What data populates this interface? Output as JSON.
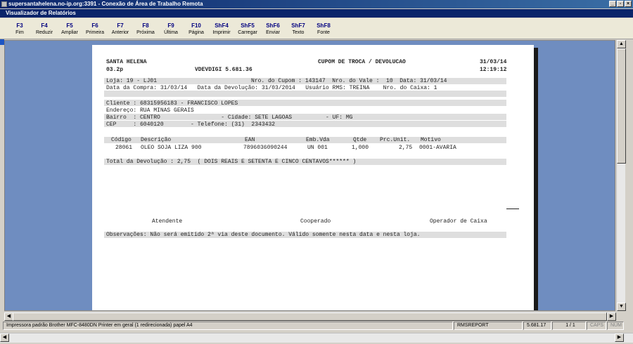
{
  "rdp_window": {
    "title": "supersantahelena.no-ip.org:3391 - Conexão de Área de Trabalho Remota"
  },
  "app": {
    "title": "Visualizador de Relatórios"
  },
  "toolbar": [
    {
      "key": "F3",
      "label": "Fim"
    },
    {
      "key": "F4",
      "label": "Reduzir"
    },
    {
      "key": "F5",
      "label": "Ampliar"
    },
    {
      "key": "F6",
      "label": "Primeira"
    },
    {
      "key": "F7",
      "label": "Anterior"
    },
    {
      "key": "F8",
      "label": "Próxima"
    },
    {
      "key": "F9",
      "label": "Última"
    },
    {
      "key": "F10",
      "label": "Página"
    },
    {
      "key": "ShF4",
      "label": "Imprimir"
    },
    {
      "key": "ShF5",
      "label": "Carregar"
    },
    {
      "key": "ShF6",
      "label": "Enviar"
    },
    {
      "key": "ShF7",
      "label": "Texto"
    },
    {
      "key": "ShF8",
      "label": "Fonte"
    }
  ],
  "report": {
    "store": "SANTA HELENA",
    "title": "CUPOM DE TROCA / DEVOLUCAO",
    "date": "31/03/14",
    "version": "03.2p",
    "system": "VDEVDIGI 5.681.36",
    "time": "12:19:12",
    "line_loja": "Loja: 19 - LJ01",
    "line_cupom": "Nro. do Cupom : 143147  Nro. do Vale :  10  Data: 31/03/14",
    "line_compra": "Data da Compra: 31/03/14   Data da Devolução: 31/03/2014   Usuário RMS: TREINA    Nro. do Caixa: 1",
    "cliente": "Cliente : 68315956183 - FRANCISCO LOPES",
    "endereco": "Endereço: RUA MINAS GERAIS",
    "bairro": "Bairro  : CENTRO                  - Cidade: SETE LAGOAS          - UF: MG",
    "cep": "CEP     : 6040120        - Telefone: (31)  2343432",
    "items_header": {
      "codigo": "Código",
      "descricao": "Descrição",
      "ean": "EAN",
      "emb": "Emb.Vda",
      "qtde": "Qtde",
      "preco": "Prc.Unit.",
      "motivo": "Motivo"
    },
    "items": [
      {
        "codigo": "28061",
        "descricao": "OLEO SOJA LIZA 900",
        "ean": "7896036090244",
        "emb": "UN 001",
        "qtde": "1,000",
        "preco": "2,75",
        "motivo": "0001-AVARIA"
      }
    ],
    "total": "Total da Devolução : 2,75  ( DOIS REAIS E SETENTA E CINCO CENTAVOS****** )",
    "signatures": [
      "Atendente",
      "Cooperado",
      "Operador de Caixa"
    ],
    "observacoes": "Observações: Não será emitido 2ª via deste documento. Válido somente nesta data e nesta loja."
  },
  "statusbar": {
    "printer": "Impressora padrão Brother MFC-8480DN Printer em geral (1 redirecionada) papel A4",
    "report_name": "RMSREPORT",
    "version": "5.681.17",
    "pages": "1 / 1",
    "caps": "CAPS",
    "num": "NUM"
  }
}
